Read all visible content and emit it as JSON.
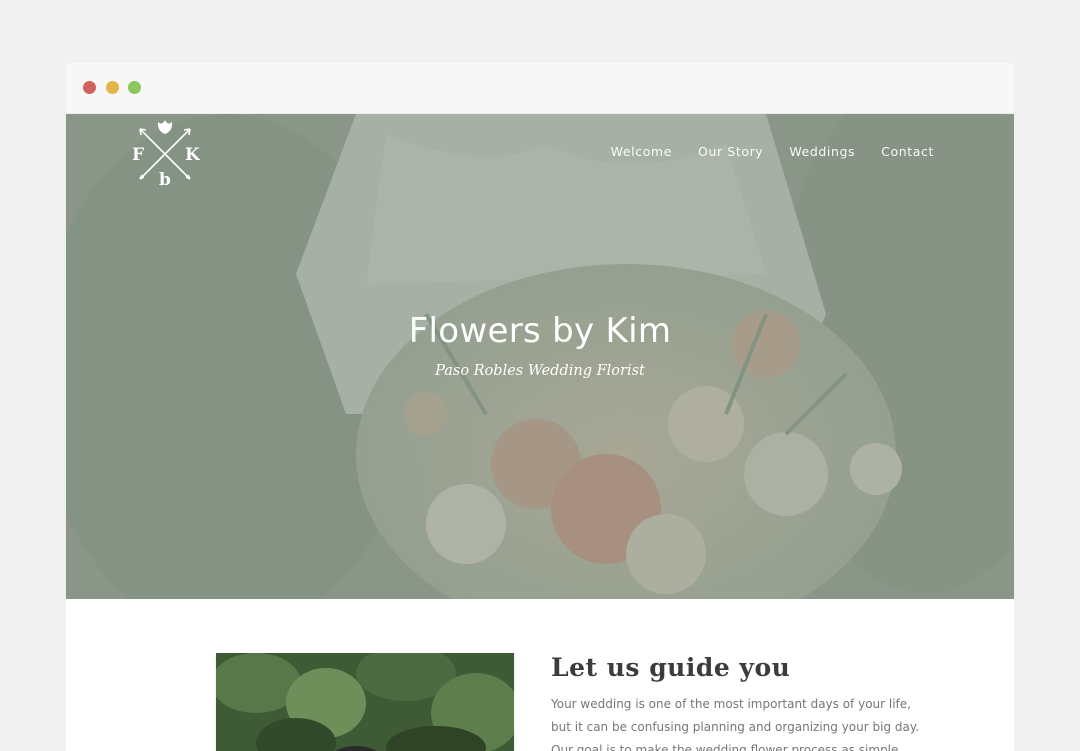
{
  "window": {
    "controls": [
      "close",
      "minimize",
      "maximize"
    ]
  },
  "header": {
    "logo": {
      "letters": [
        "F",
        "K",
        "b"
      ],
      "icon": "crossed-arrows-tulip-monogram"
    },
    "nav": [
      {
        "label": "Welcome"
      },
      {
        "label": "Our Story"
      },
      {
        "label": "Weddings"
      },
      {
        "label": "Contact"
      }
    ]
  },
  "hero": {
    "title": "Flowers by Kim",
    "subtitle": "Paso Robles Wedding Florist",
    "overlay_color": "#8d9b8f"
  },
  "intro": {
    "heading": "Let us guide you",
    "lines": [
      "Your wedding is one of the most important days of your life,",
      "but it can be confusing planning and organizing your big day.",
      "Our goal is to make the wedding flower process as simple"
    ]
  },
  "colors": {
    "background": "#f1f1f1",
    "titlebar": "#f7f7f7",
    "close": "#d0615e",
    "minimize": "#e2b64a",
    "maximize": "#8dc55e",
    "heading": "#3c3c3c",
    "body_text": "#777777"
  }
}
